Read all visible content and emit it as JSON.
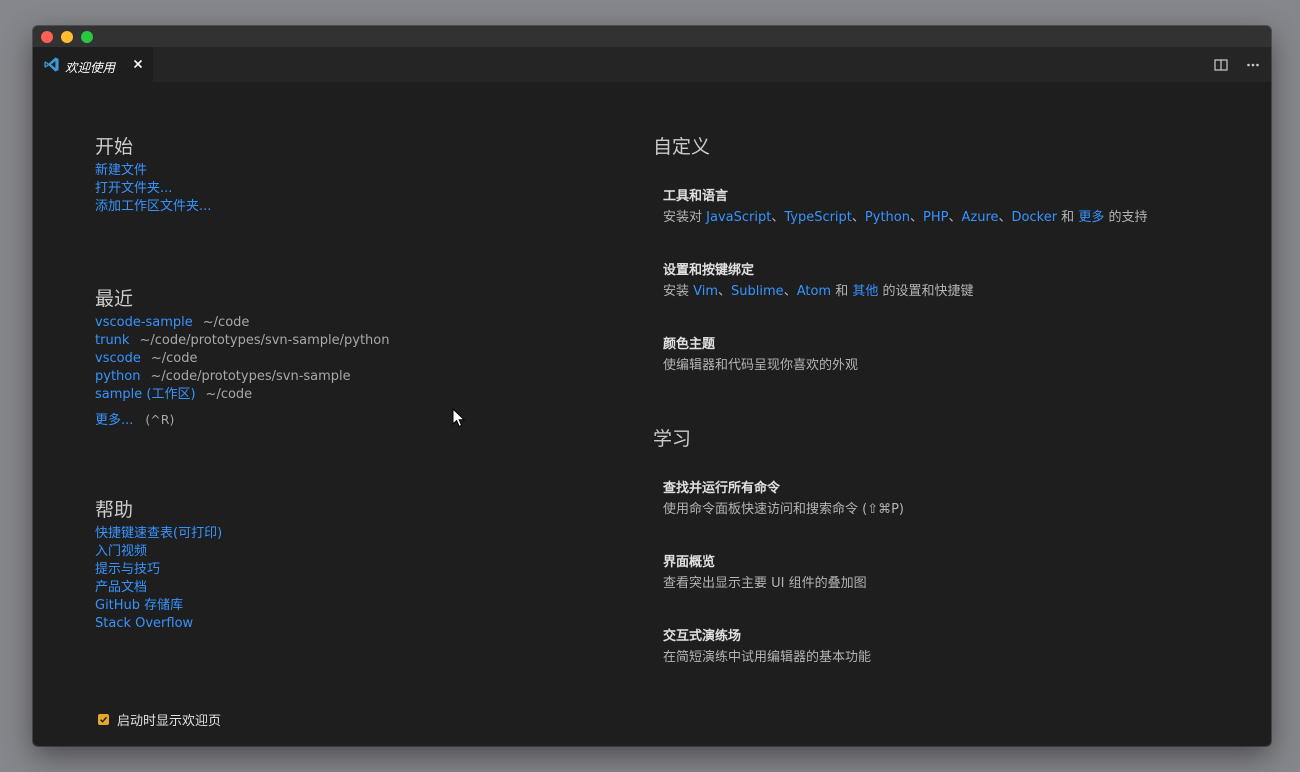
{
  "tab": {
    "title": "欢迎使用"
  },
  "start": {
    "title": "开始",
    "links": [
      "新建文件",
      "打开文件夹...",
      "添加工作区文件夹..."
    ]
  },
  "recent": {
    "title": "最近",
    "items": [
      {
        "name": "vscode-sample",
        "path": "~/code"
      },
      {
        "name": "trunk",
        "path": "~/code/prototypes/svn-sample/python"
      },
      {
        "name": "vscode",
        "path": "~/code"
      },
      {
        "name": "python",
        "path": "~/code/prototypes/svn-sample"
      },
      {
        "name": "sample (工作区)",
        "path": "~/code"
      }
    ],
    "more_label": "更多...",
    "more_shortcut": "(^R)"
  },
  "help": {
    "title": "帮助",
    "links": [
      "快捷键速查表(可打印)",
      "入门视频",
      "提示与技巧",
      "产品文档",
      "GitHub 存储库",
      "Stack Overflow"
    ]
  },
  "startup": {
    "label": "启动时显示欢迎页",
    "checked": true
  },
  "customize": {
    "title": "自定义",
    "tools": {
      "title": "工具和语言",
      "prefix": "安装对 ",
      "langs": [
        "JavaScript",
        "TypeScript",
        "Python",
        "PHP",
        "Azure",
        "Docker"
      ],
      "sep": "、",
      "and": " 和 ",
      "more": "更多",
      "suffix": " 的支持"
    },
    "keys": {
      "title": "设置和按键绑定",
      "prefix": "安装 ",
      "editors": [
        "Vim",
        "Sublime",
        "Atom"
      ],
      "sep": "、",
      "and": " 和 ",
      "other": "其他",
      "suffix": " 的设置和快捷键"
    },
    "theme": {
      "title": "颜色主题",
      "desc": "使编辑器和代码呈现你喜欢的外观"
    }
  },
  "learn": {
    "title": "学习",
    "items": [
      {
        "title": "查找并运行所有命令",
        "desc": "使用命令面板快速访问和搜索命令 (⇧⌘P)"
      },
      {
        "title": "界面概览",
        "desc": "查看突出显示主要 UI 组件的叠加图"
      },
      {
        "title": "交互式演练场",
        "desc": "在简短演练中试用编辑器的基本功能"
      }
    ]
  },
  "colors": {
    "link": "#3794ff",
    "background": "#1e1e1e",
    "checkbox": "#e7a82a"
  },
  "icons": [
    "vscode-logo-icon",
    "close-icon",
    "split-editor-icon",
    "more-actions-icon",
    "checkmark-icon",
    "mouse-cursor-icon"
  ]
}
